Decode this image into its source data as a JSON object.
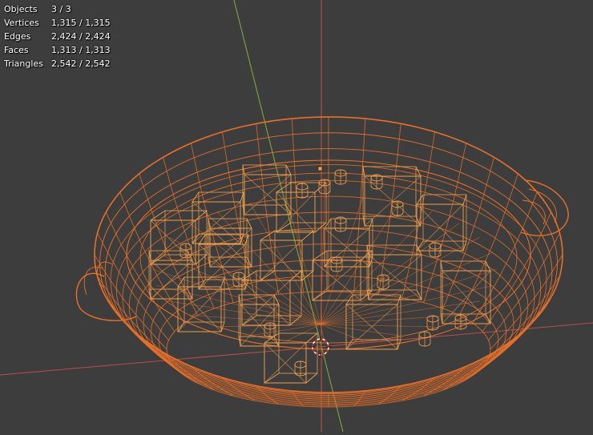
{
  "overlay": {
    "stats": [
      {
        "label": "Objects",
        "value": "3 / 3"
      },
      {
        "label": "Vertices",
        "value": "1,315 / 1,315"
      },
      {
        "label": "Edges",
        "value": "2,424 / 2,424"
      },
      {
        "label": "Faces",
        "value": "1,313 / 1,313"
      },
      {
        "label": "Triangles",
        "value": "2,542 / 2,542"
      }
    ]
  },
  "viewport": {
    "background": "#3d3d3d",
    "wire_color": "#e8702a",
    "wire_light_color": "#f0a050",
    "axis_x_color": "#b84e4e",
    "axis_y_color": "#7d9c3a",
    "cursor_color": "#ffffff"
  }
}
